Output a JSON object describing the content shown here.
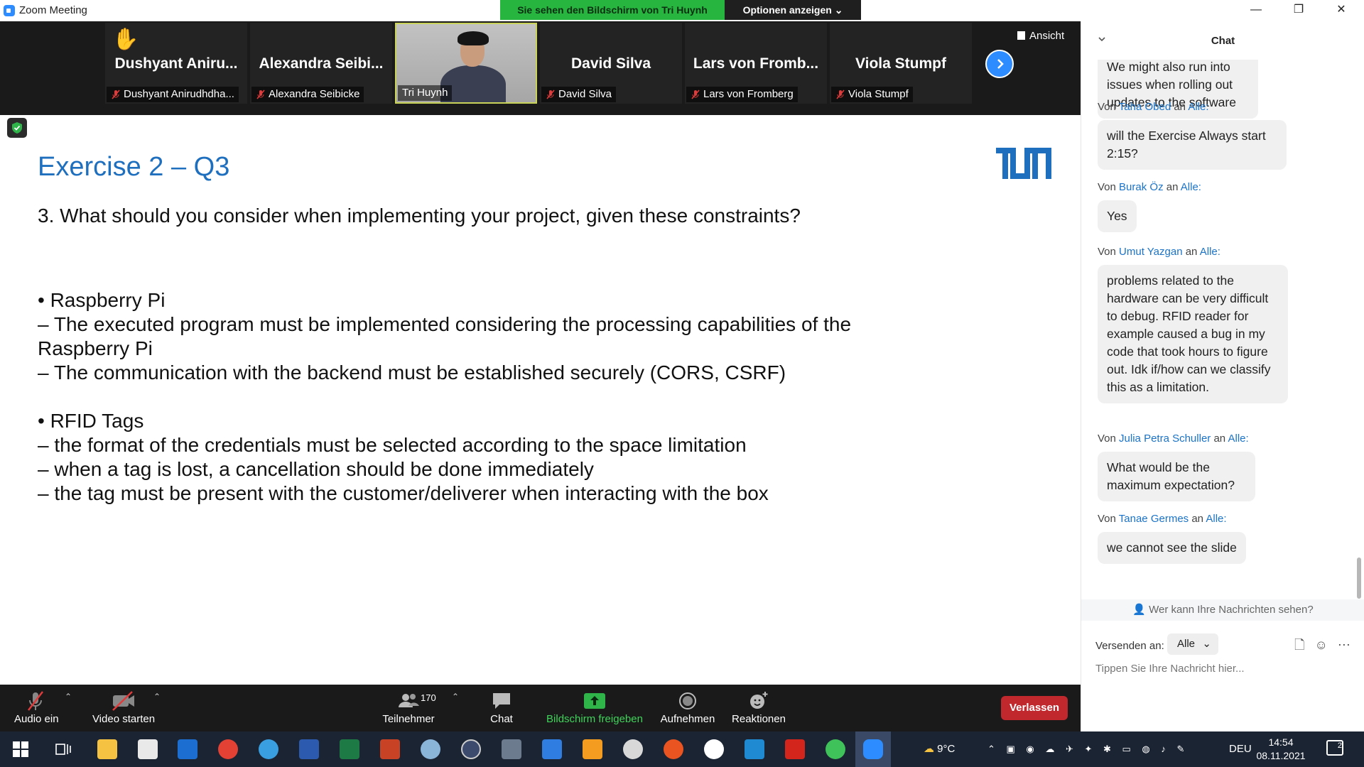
{
  "window": {
    "title": "Zoom Meeting",
    "share_banner": "Sie sehen den Bildschirm von Tri Huynh",
    "options_button": "Optionen anzeigen",
    "view_button": "Ansicht"
  },
  "gallery": {
    "tiles": [
      {
        "big_name": "Dushyant Aniru...",
        "small_name": "Dushyant Anirudhdha...",
        "muted": true,
        "hand_raised": true
      },
      {
        "big_name": "Alexandra Seibi...",
        "small_name": "Alexandra Seibicke",
        "muted": true
      },
      {
        "big_name": "",
        "small_name": "Tri Huynh",
        "muted": false,
        "video": true
      },
      {
        "big_name": "David Silva",
        "small_name": "David Silva",
        "muted": true
      },
      {
        "big_name": "Lars von Fromb...",
        "small_name": "Lars von Fromberg",
        "muted": true
      },
      {
        "big_name": "Viola Stumpf",
        "small_name": "Viola Stumpf",
        "muted": true
      }
    ]
  },
  "slide": {
    "title": "Exercise 2 – Q3",
    "question": "3. What should you consider when implementing your project, given these constraints?",
    "lines": [
      "• Raspberry Pi",
      "– The executed program must be implemented considering the processing capabilities of the",
      "Raspberry Pi",
      "– The communication with the backend must be established securely (CORS, CSRF)",
      "",
      "• RFID Tags",
      "– the format of the credentials must be selected according to the space limitation",
      "– when a tag is lost, a cancellation should be done immediately",
      "– the tag must be present with the customer/deliverer when interacting with the box"
    ]
  },
  "chat": {
    "title": "Chat",
    "from_prefix": "Von",
    "to_connector": "an",
    "to_label": "Alle:",
    "partial_message": "We might also run into issues when rolling out updates to the software",
    "messages": [
      {
        "sender": "Taha Obed",
        "text": "will the Exercise Always start 2:15?"
      },
      {
        "sender": "Burak Öz",
        "text": "Yes"
      },
      {
        "sender": "Umut Yazgan",
        "text": "problems related to the hardware can be very difficult to debug. RFID reader for example caused a bug in my code that took hours to figure out. Idk if/how can we classify this as a limitation."
      },
      {
        "sender": "Julia Petra Schuller",
        "text": "What would be the maximum expectation?"
      },
      {
        "sender": "Tanae Germes",
        "text": "we cannot see the slide"
      }
    ],
    "who_can_see": "Wer kann Ihre Nachrichten sehen?",
    "send_to_label": "Versenden an:",
    "recipient": "Alle",
    "input_placeholder": "Tippen Sie Ihre Nachricht hier..."
  },
  "toolbar": {
    "audio": "Audio ein",
    "video": "Video starten",
    "participants": "Teilnehmer",
    "participant_count": "170",
    "chat": "Chat",
    "share": "Bildschirm freigeben",
    "record": "Aufnehmen",
    "reactions": "Reaktionen",
    "leave": "Verlassen"
  },
  "taskbar": {
    "weather": "9°C",
    "language": "DEU",
    "time": "14:54",
    "date": "08.11.2021",
    "notifications": "2",
    "icons": [
      "start-icon",
      "task-view-icon",
      "file-explorer-icon",
      "store-icon",
      "outlook-icon",
      "chrome-icon",
      "telegram-icon",
      "word-icon",
      "excel-icon",
      "powerpoint-icon",
      "snipping-icon",
      "keepass-icon",
      "calculator-icon",
      "todo-icon",
      "sublime-icon",
      "gitkraken-icon",
      "ubuntu-icon",
      "slack-icon",
      "vscode-icon",
      "acrobat-icon",
      "whatsapp-icon",
      "zoom-icon"
    ]
  },
  "colors": {
    "accent": "#2d8cff",
    "share_green": "#27b53f",
    "slide_title": "#1f6fbf",
    "leave_red": "#c0282d",
    "chat_name": "#1a73c8"
  }
}
